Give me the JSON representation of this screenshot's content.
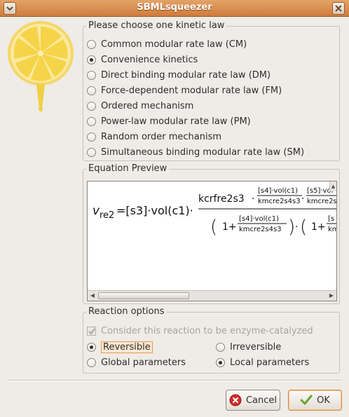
{
  "window": {
    "title": "SBMLsqueezer"
  },
  "kinetic_law": {
    "legend": "Please choose one kinetic law",
    "options": [
      {
        "label": "Common modular rate law (CM)",
        "selected": false
      },
      {
        "label": "Convenience kinetics",
        "selected": true
      },
      {
        "label": "Direct binding modular rate law (DM)",
        "selected": false
      },
      {
        "label": "Force-dependent modular rate law (FM)",
        "selected": false
      },
      {
        "label": "Ordered mechanism",
        "selected": false
      },
      {
        "label": "Power-law modular rate law (PM)",
        "selected": false
      },
      {
        "label": "Random order mechanism",
        "selected": false
      },
      {
        "label": "Simultaneous binding modular rate law (SM)",
        "selected": false
      }
    ]
  },
  "equation_preview": {
    "legend": "Equation Preview",
    "v": "v",
    "v_sub": "re2",
    "lhs_rest": "=[s3]·vol(c1)·",
    "kcr": "kcrfre2s3",
    "dot": "·",
    "frac1_num": "[s4]·vol(c1)",
    "frac1_den": "kmcre2s4s3",
    "frac2_num": "[s5]·vol",
    "frac2_den": "kmcre2s",
    "one_plus": "1+",
    "den_frac_num": "[s4]·vol(c1)",
    "den_frac_den": "kmcre2s4s3",
    "den2_num": "[s",
    "den2_den": "km"
  },
  "reaction_options": {
    "legend": "Reaction options",
    "enzyme_label": "Consider this reaction to be enzyme-catalyzed",
    "enzyme_checked": true,
    "reversible_label": "Reversible",
    "reversible_selected": true,
    "irreversible_label": "Irreversible",
    "irreversible_selected": false,
    "global_label": "Global parameters",
    "global_selected": false,
    "local_label": "Local parameters",
    "local_selected": true
  },
  "buttons": {
    "cancel_label": "Cancel",
    "ok_label": "OK"
  },
  "colors": {
    "title_bar": "#d88d4f",
    "accent": "#e39b4d",
    "cancel_icon": "#d22c2c",
    "ok_icon": "#6aa52b"
  }
}
